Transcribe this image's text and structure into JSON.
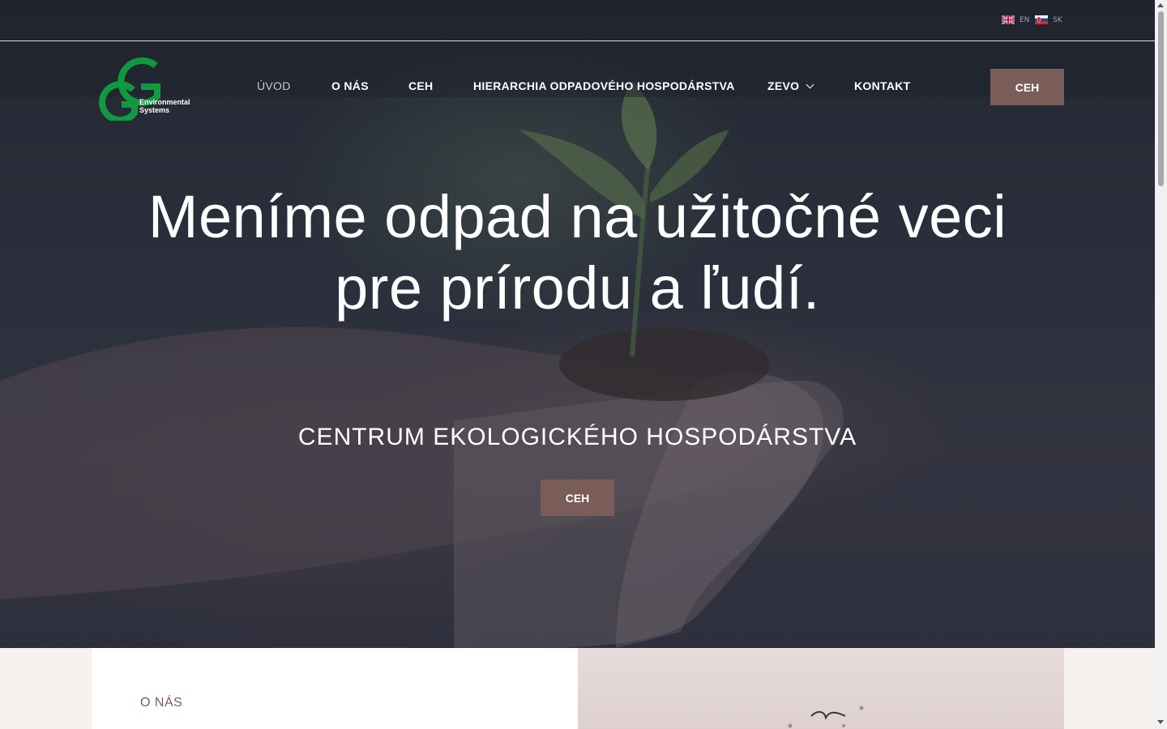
{
  "languages": [
    {
      "code": "EN",
      "flag": "uk-flag-icon"
    },
    {
      "code": "SK",
      "flag": "slovakia-flag-icon"
    }
  ],
  "logo": {
    "letters": "GG",
    "line1": "Environmental",
    "line2": "Systems",
    "brand_color": "#0f9a3e"
  },
  "nav": {
    "items": [
      {
        "label": "ÚVOD",
        "active": true
      },
      {
        "label": "O NÁS"
      },
      {
        "label": "CEH"
      },
      {
        "label": "HIERARCHIA ODPADOVÉHO HOSPODÁRSTVA"
      },
      {
        "label": "ZEVO",
        "icon": "chevron-down-icon"
      },
      {
        "label": "KONTAKT"
      }
    ],
    "cta_label": "CEH"
  },
  "hero": {
    "headline_line1": "Meníme odpad na užitočné veci",
    "headline_line2": "pre prírodu a ľudí.",
    "subheading": "CENTRUM EKOLOGICKÉHO HOSPODÁRSTVA",
    "button_label": "CEH"
  },
  "about": {
    "label": "O NÁS"
  },
  "colors": {
    "accent": "#7a5d59",
    "hero_overlay": "#1e2330",
    "section_bg": "#f6f0ef"
  }
}
